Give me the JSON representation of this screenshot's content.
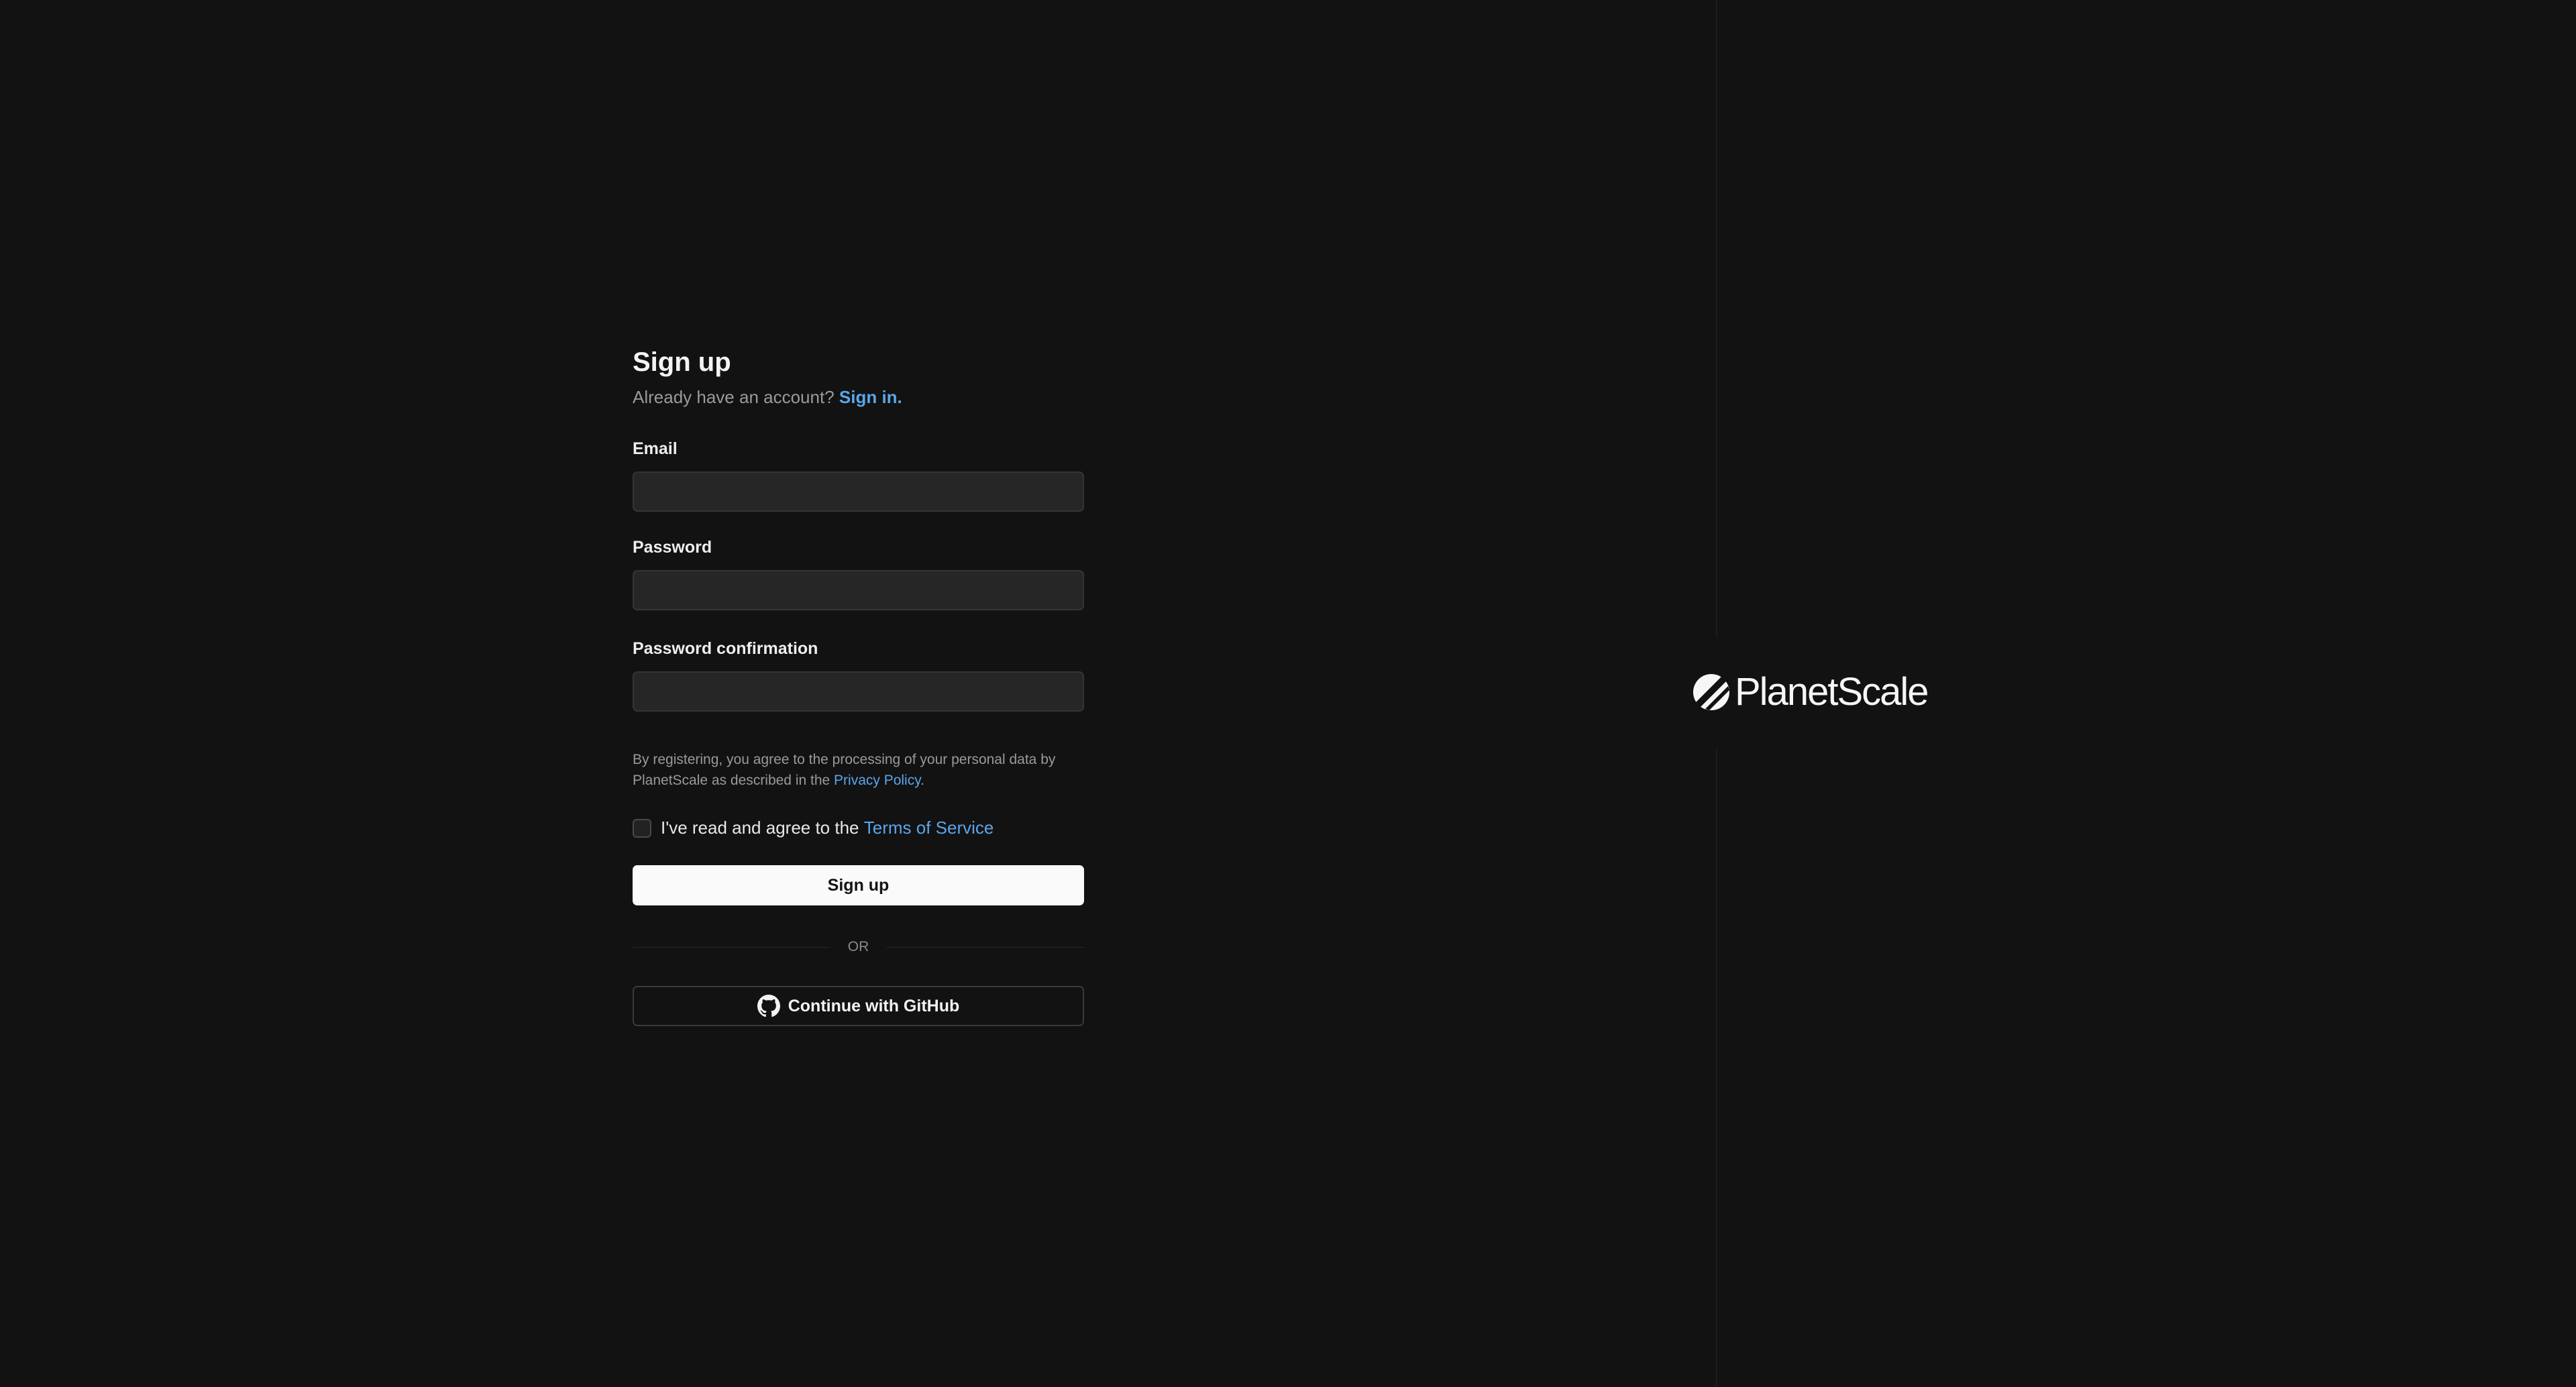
{
  "signup": {
    "title": "Sign up",
    "subtitle_prefix": "Already have an account?",
    "signin_link": "Sign in."
  },
  "form": {
    "email_label": "Email",
    "email_value": "",
    "password_label": "Password",
    "password_value": "",
    "password_confirm_label": "Password confirmation",
    "password_confirm_value": ""
  },
  "consent": {
    "text_prefix": "By registering, you agree to the processing of your personal data by PlanetScale as described in the",
    "privacy_link": "Privacy Policy",
    "text_suffix": "."
  },
  "terms": {
    "checked": false,
    "text_prefix": "I've read and agree to the",
    "link": "Terms of Service"
  },
  "buttons": {
    "signup_label": "Sign up",
    "divider_label": "OR",
    "github_label": "Continue with GitHub"
  },
  "brand": {
    "name": "PlanetScale",
    "icon": "planetscale-logo-icon"
  },
  "colors": {
    "background": "#121212",
    "link": "#5aa6ea",
    "primary_button": "#fafafa",
    "input_bg": "#262626"
  }
}
